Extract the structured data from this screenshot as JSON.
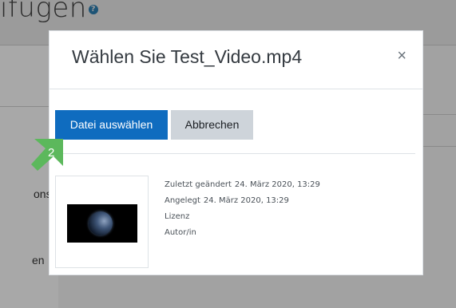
{
  "background": {
    "heading_fragment": "ıfügen",
    "help_glyph": "?",
    "left_text_1": "ons",
    "left_text_2": "en"
  },
  "modal": {
    "title": "Wählen Sie Test_Video.mp4",
    "close_glyph": "×",
    "select_button": "Datei auswählen",
    "cancel_button": "Abbrechen",
    "meta": {
      "modified_label": "Zuletzt geändert",
      "modified_value": "24. März 2020, 13:29",
      "created_label": "Angelegt",
      "created_value": "24. März 2020, 13:29",
      "license_label": "Lizenz",
      "author_label": "Autor/in"
    }
  },
  "step_badge": {
    "number": "2",
    "color": "#5cb85c"
  },
  "colors": {
    "primary": "#0f6cbf",
    "secondary": "#ced4da",
    "overlay": "#9b9b9b"
  }
}
